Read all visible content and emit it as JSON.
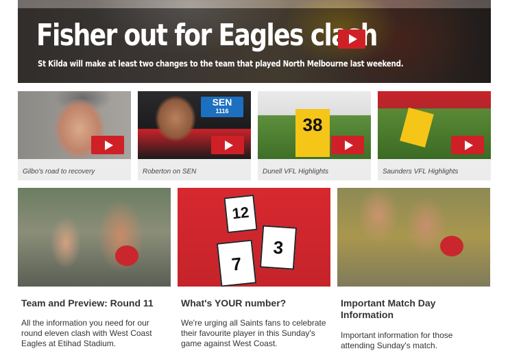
{
  "hero": {
    "title": "Fisher out for Eagles clash",
    "subtitle": "St Kilda will make at least two changes to the team that played North Melbourne last weekend."
  },
  "videos": [
    {
      "caption": "Gilbo's road to recovery"
    },
    {
      "caption": "Roberton on SEN",
      "badge_top": "SEN",
      "badge_bottom": "1116"
    },
    {
      "caption": "Dunell VFL Highlights",
      "guernsey_number": "38"
    },
    {
      "caption": "Saunders VFL Highlights"
    }
  ],
  "features": [
    {
      "title": "Team and Preview: Round 11",
      "text": "All the information you need for our round eleven clash with West Coast Eagles at Etihad Stadium."
    },
    {
      "title": "What's YOUR number?",
      "text": "We're urging all Saints fans to celebrate their favourite player in this Sunday's game against West Coast.",
      "sign_numbers": [
        "12",
        "3",
        "7"
      ]
    },
    {
      "title": "Important Match Day Information",
      "text": "Important information for those attending Sunday's match."
    }
  ],
  "colors": {
    "accent": "#cf2027",
    "caption_bg": "#ececec",
    "text": "#333333"
  },
  "icons": {
    "play": "play-icon"
  }
}
